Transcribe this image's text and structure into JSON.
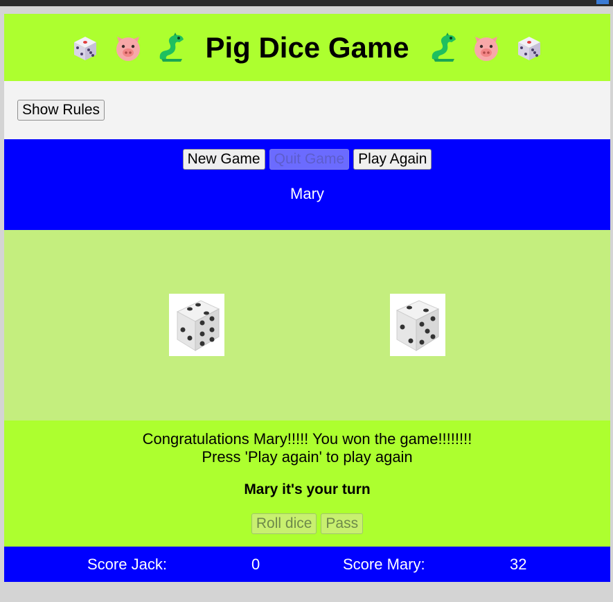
{
  "header": {
    "title": "Pig Dice Game",
    "icons": [
      "dice-icon",
      "pig-icon",
      "dragon-icon",
      "dragon-icon",
      "pig-icon",
      "dice-icon"
    ]
  },
  "rules": {
    "show_rules_label": "Show Rules"
  },
  "controls": {
    "new_game_label": "New Game",
    "quit_game_label": "Quit Game",
    "play_again_label": "Play Again",
    "current_player": "Mary"
  },
  "dice": [
    {
      "name": "left-die",
      "value": 6
    },
    {
      "name": "right-die",
      "value": 5
    }
  ],
  "status": {
    "message_line1": "Congratulations Mary!!!!! You won the game!!!!!!!!",
    "message_line2": "Press 'Play again' to play again",
    "turn_text": "Mary it's your turn",
    "roll_dice_label": "Roll dice",
    "pass_label": "Pass"
  },
  "scores": {
    "jack_label": "Score Jack:",
    "jack_value": "0",
    "mary_label": "Score Mary:",
    "mary_value": "32"
  },
  "colors": {
    "header_bg": "#adff2f",
    "control_bg": "#0000ff",
    "dice_area_bg": "#c4ee7e"
  }
}
